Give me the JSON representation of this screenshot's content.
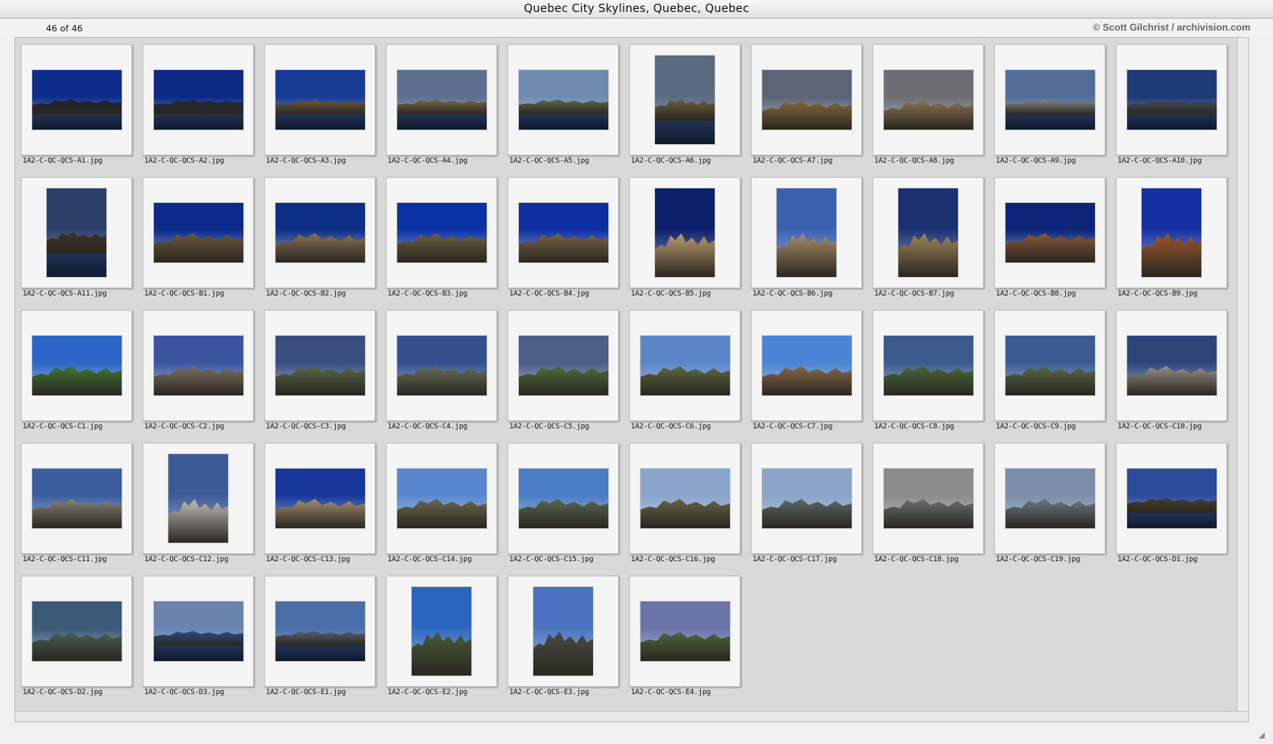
{
  "window": {
    "title": "Quebec City Skylines, Quebec, Quebec"
  },
  "info": {
    "count": "46 of 46",
    "credit": "© Scott Gilchrist / archivision.com"
  },
  "thumbnails": [
    {
      "file": "1A2-C-QC-QCS-A1.jpg",
      "orientation": "landscape",
      "sky": "#0d2d8a",
      "land": "#1b2430",
      "water": true
    },
    {
      "file": "1A2-C-QC-QCS-A2.jpg",
      "orientation": "landscape",
      "sky": "#0c2a85",
      "land": "#1f2a36",
      "water": true
    },
    {
      "file": "1A2-C-QC-QCS-A3.jpg",
      "orientation": "landscape",
      "sky": "#163c96",
      "land": "#6a5a3c",
      "water": true
    },
    {
      "file": "1A2-C-QC-QCS-A4.jpg",
      "orientation": "landscape",
      "sky": "#5e7090",
      "land": "#7a6a44",
      "water": true
    },
    {
      "file": "1A2-C-QC-QCS-A5.jpg",
      "orientation": "landscape",
      "sky": "#6f8bb0",
      "land": "#5b6b48",
      "water": true
    },
    {
      "file": "1A2-C-QC-QCS-A6.jpg",
      "orientation": "portrait",
      "sky": "#5a6a82",
      "land": "#6e5e3c",
      "water": true
    },
    {
      "file": "1A2-C-QC-QCS-A7.jpg",
      "orientation": "landscape",
      "sky": "#5c6478",
      "land": "#8a6a3a",
      "water": false
    },
    {
      "file": "1A2-C-QC-QCS-A8.jpg",
      "orientation": "landscape",
      "sky": "#6e6c74",
      "land": "#8c7450",
      "water": false
    },
    {
      "file": "1A2-C-QC-QCS-A9.jpg",
      "orientation": "landscape",
      "sky": "#546e9a",
      "land": "#8a8a88",
      "water": true
    },
    {
      "file": "1A2-C-QC-QCS-A10.jpg",
      "orientation": "landscape",
      "sky": "#1e3a78",
      "land": "#44505a",
      "water": true
    },
    {
      "file": "1A2-C-QC-QCS-A11.jpg",
      "orientation": "portrait",
      "sky": "#2c3e6a",
      "land": "#3a3428",
      "water": true
    },
    {
      "file": "1A2-C-QC-QCS-B1.jpg",
      "orientation": "landscape",
      "sky": "#0a2a8c",
      "land": "#6a5a3a",
      "water": false
    },
    {
      "file": "1A2-C-QC-QCS-B2.jpg",
      "orientation": "landscape",
      "sky": "#0e2f86",
      "land": "#8a7654",
      "water": false
    },
    {
      "file": "1A2-C-QC-QCS-B3.jpg",
      "orientation": "landscape",
      "sky": "#0b31a6",
      "land": "#6c6244",
      "water": false
    },
    {
      "file": "1A2-C-QC-QCS-B4.jpg",
      "orientation": "landscape",
      "sky": "#0d2fa2",
      "land": "#7a6846",
      "water": false
    },
    {
      "file": "1A2-C-QC-QCS-B5.jpg",
      "orientation": "portrait",
      "sky": "#0a1e6a",
      "land": "#c2a274",
      "water": false
    },
    {
      "file": "1A2-C-QC-QCS-B6.jpg",
      "orientation": "portrait",
      "sky": "#3a60b0",
      "land": "#b0946a",
      "water": false
    },
    {
      "file": "1A2-C-QC-QCS-B7.jpg",
      "orientation": "portrait",
      "sky": "#1a3070",
      "land": "#a48a5c",
      "water": false
    },
    {
      "file": "1A2-C-QC-QCS-B8.jpg",
      "orientation": "landscape",
      "sky": "#0d2478",
      "land": "#8a5a3a",
      "water": false
    },
    {
      "file": "1A2-C-QC-QCS-B9.jpg",
      "orientation": "portrait",
      "sky": "#1430a0",
      "land": "#a05a2a",
      "water": false
    },
    {
      "file": "1A2-C-QC-QCS-C1.jpg",
      "orientation": "landscape",
      "sky": "#2c66c8",
      "land": "#3e7a2e",
      "water": false
    },
    {
      "file": "1A2-C-QC-QCS-C2.jpg",
      "orientation": "landscape",
      "sky": "#3a56a0",
      "land": "#7c7464",
      "water": false
    },
    {
      "file": "1A2-C-QC-QCS-C3.jpg",
      "orientation": "landscape",
      "sky": "#3a4e80",
      "land": "#5a6a48",
      "water": false
    },
    {
      "file": "1A2-C-QC-QCS-C4.jpg",
      "orientation": "landscape",
      "sky": "#34508e",
      "land": "#6a6e5a",
      "water": false
    },
    {
      "file": "1A2-C-QC-QCS-C5.jpg",
      "orientation": "landscape",
      "sky": "#4a5e88",
      "land": "#4c7038",
      "water": false
    },
    {
      "file": "1A2-C-QC-QCS-C6.jpg",
      "orientation": "landscape",
      "sky": "#5a86c8",
      "land": "#5e6a44",
      "water": false
    },
    {
      "file": "1A2-C-QC-QCS-C7.jpg",
      "orientation": "landscape",
      "sky": "#4a84d4",
      "land": "#8c6a48",
      "water": false
    },
    {
      "file": "1A2-C-QC-QCS-C8.jpg",
      "orientation": "landscape",
      "sky": "#3c5a8e",
      "land": "#4a6a3a",
      "water": false
    },
    {
      "file": "1A2-C-QC-QCS-C9.jpg",
      "orientation": "landscape",
      "sky": "#3a5c92",
      "land": "#5a6a48",
      "water": false
    },
    {
      "file": "1A2-C-QC-QCS-C10.jpg",
      "orientation": "landscape",
      "sky": "#2c467a",
      "land": "#9a9488",
      "water": false
    },
    {
      "file": "1A2-C-QC-QCS-C11.jpg",
      "orientation": "landscape",
      "sky": "#3a5e9e",
      "land": "#8a8478",
      "water": false
    },
    {
      "file": "1A2-C-QC-QCS-C12.jpg",
      "orientation": "portrait",
      "sky": "#3c5a98",
      "land": "#c8c4bc",
      "water": false
    },
    {
      "file": "1A2-C-QC-QCS-C13.jpg",
      "orientation": "landscape",
      "sky": "#16389a",
      "land": "#a69272",
      "water": false
    },
    {
      "file": "1A2-C-QC-QCS-C14.jpg",
      "orientation": "landscape",
      "sky": "#5a88d0",
      "land": "#6e6a4c",
      "water": false
    },
    {
      "file": "1A2-C-QC-QCS-C15.jpg",
      "orientation": "landscape",
      "sky": "#4a7cc6",
      "land": "#5a6a52",
      "water": false
    },
    {
      "file": "1A2-C-QC-QCS-C16.jpg",
      "orientation": "landscape",
      "sky": "#8aa6cc",
      "land": "#6a6448",
      "water": false
    },
    {
      "file": "1A2-C-QC-QCS-C17.jpg",
      "orientation": "landscape",
      "sky": "#8aa4c8",
      "land": "#5e6a68",
      "water": false
    },
    {
      "file": "1A2-C-QC-QCS-C18.jpg",
      "orientation": "landscape",
      "sky": "#8a8c88",
      "land": "#6a7470",
      "water": false
    },
    {
      "file": "1A2-C-QC-QCS-C19.jpg",
      "orientation": "landscape",
      "sky": "#7a8ea8",
      "land": "#6c7c84",
      "water": false
    },
    {
      "file": "1A2-C-QC-QCS-D1.jpg",
      "orientation": "landscape",
      "sky": "#2a4c9a",
      "land": "#4a3e30",
      "water": true
    },
    {
      "file": "1A2-C-QC-QCS-D2.jpg",
      "orientation": "landscape",
      "sky": "#3a5a78",
      "land": "#4a6258",
      "water": false
    },
    {
      "file": "1A2-C-QC-QCS-D3.jpg",
      "orientation": "landscape",
      "sky": "#6a84b0",
      "land": "#2a4e8a",
      "water": true
    },
    {
      "file": "1A2-C-QC-QCS-E1.jpg",
      "orientation": "landscape",
      "sky": "#4a6ea8",
      "land": "#5a6070",
      "water": true
    },
    {
      "file": "1A2-C-QC-QCS-E2.jpg",
      "orientation": "portrait",
      "sky": "#2a66c0",
      "land": "#4a5e3a",
      "water": false
    },
    {
      "file": "1A2-C-QC-QCS-E3.jpg",
      "orientation": "portrait",
      "sky": "#4a72c0",
      "land": "#4a4e44",
      "water": false
    },
    {
      "file": "1A2-C-QC-QCS-E4.jpg",
      "orientation": "landscape",
      "sky": "#6a74a8",
      "land": "#4e6a40",
      "water": false
    }
  ]
}
